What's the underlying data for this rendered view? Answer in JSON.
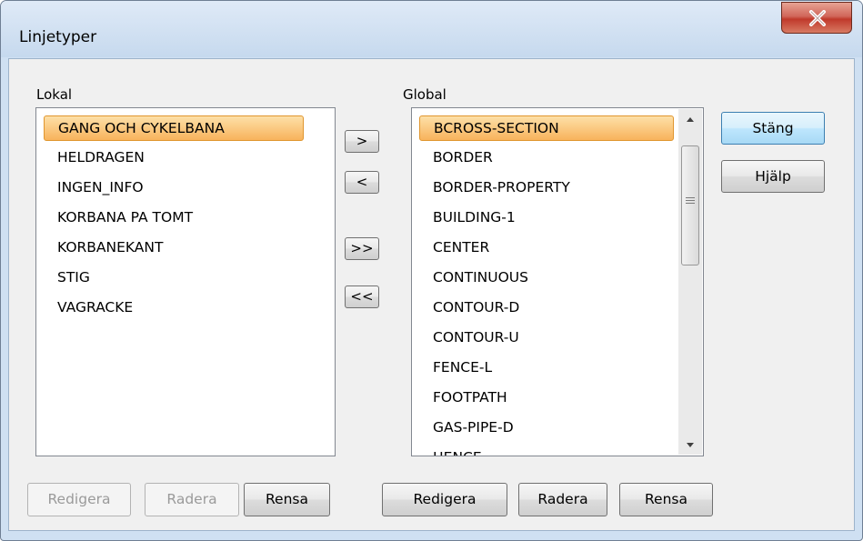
{
  "window": {
    "title": "Linjetyper",
    "close_glyph": "X"
  },
  "lokal": {
    "label": "Lokal",
    "items": [
      "GANG OCH CYKELBANA",
      "HELDRAGEN",
      "INGEN_INFO",
      "KORBANA PA TOMT",
      "KORBANEKANT",
      "STIG",
      "VAGRACKE"
    ],
    "selected_index": 0,
    "buttons": {
      "edit": "Redigera",
      "delete": "Radera",
      "clear": "Rensa"
    }
  },
  "transfer": {
    "add": ">",
    "remove": "<",
    "add_all": ">>",
    "remove_all": "<<"
  },
  "global": {
    "label": "Global",
    "items": [
      "BCROSS-SECTION",
      "BORDER",
      "BORDER-PROPERTY",
      "BUILDING-1",
      "CENTER",
      "CONTINUOUS",
      "CONTOUR-D",
      "CONTOUR-U",
      "FENCE-L",
      "FOOTPATH",
      "GAS-PIPE-D",
      "HENCE"
    ],
    "selected_index": 0,
    "buttons": {
      "edit": "Redigera",
      "delete": "Radera",
      "clear": "Rensa"
    }
  },
  "actions": {
    "close": "Stäng",
    "help": "Hjälp"
  },
  "colors": {
    "selection": "#f8b35c",
    "default_button": "#bee6fd",
    "close_button": "#c0392b"
  },
  "icons": {
    "close": "close-icon",
    "scroll_up": "chevron-up-icon",
    "scroll_down": "chevron-down-icon"
  }
}
